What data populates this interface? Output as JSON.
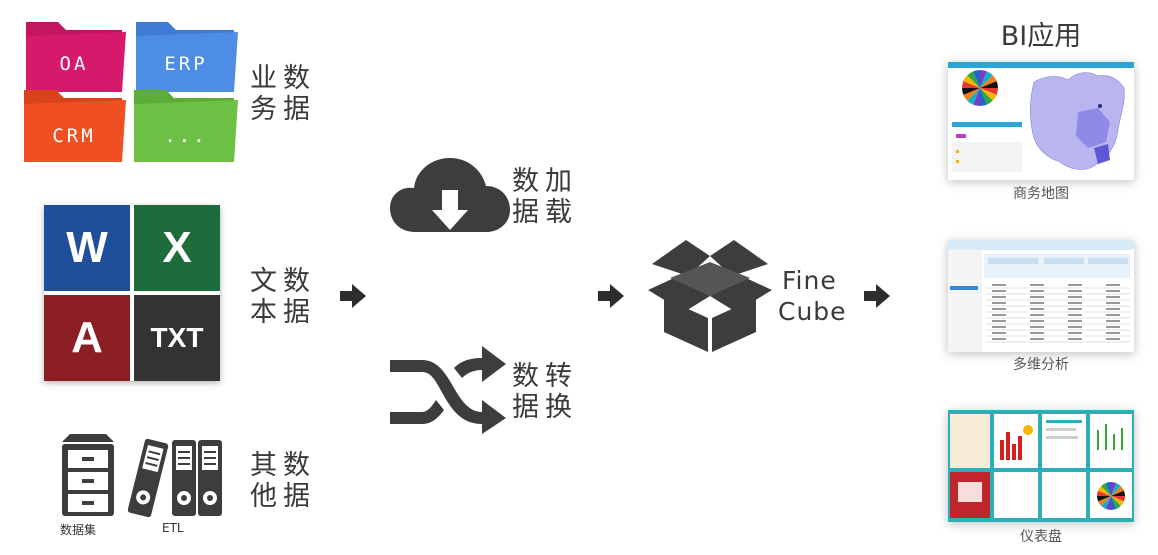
{
  "business_data": {
    "folders": [
      {
        "label": "OA",
        "color": "#d6196b"
      },
      {
        "label": "ERP",
        "color": "#4d8de6"
      },
      {
        "label": "CRM",
        "color": "#ef4f23"
      },
      {
        "label": "...",
        "color": "#6cc043"
      }
    ],
    "label": [
      "业",
      "务",
      "数",
      "据"
    ]
  },
  "text_data": {
    "tiles": [
      {
        "label": "W",
        "color": "#1f4e9a"
      },
      {
        "label": "X",
        "color": "#1e6b3c"
      },
      {
        "label": "A",
        "color": "#8b1e23"
      },
      {
        "label": "TXT",
        "color": "#333333"
      }
    ],
    "label": [
      "文",
      "本",
      "数",
      "据"
    ]
  },
  "other_data": {
    "dataset_caption": "数据集",
    "etl_caption": "ETL",
    "label": [
      "其",
      "他",
      "数",
      "据"
    ]
  },
  "data_load": {
    "label": [
      "数",
      "据",
      "加",
      "载"
    ]
  },
  "data_transform": {
    "label": [
      "数",
      "据",
      "转",
      "换"
    ]
  },
  "cube": {
    "line1": "Fine",
    "line2": "Cube"
  },
  "bi": {
    "title": "BI应用",
    "apps": [
      {
        "caption": "商务地图"
      },
      {
        "caption": "多维分析"
      },
      {
        "caption": "仪表盘"
      }
    ]
  },
  "colors": {
    "icon_dark": "#3d3d3d",
    "pie": [
      "#e8372d",
      "#f7b500",
      "#2ea74a",
      "#1f66c8",
      "#7a3cc4",
      "#0fb3c9",
      "#f07f1b",
      "#111111"
    ]
  }
}
